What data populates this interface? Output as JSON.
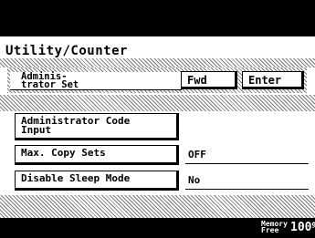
{
  "screen": {
    "title": "Utility/Counter",
    "header": {
      "admin_line1": "Adminis-",
      "admin_line2": "trator Set",
      "fwd_label": "Fwd",
      "enter_label": "Enter"
    },
    "items": [
      {
        "label_line1": "Administrator Code",
        "label_line2": "Input"
      },
      {
        "label": "Max. Copy Sets",
        "value": "OFF"
      },
      {
        "label": "Disable Sleep Mode",
        "value": "No"
      }
    ],
    "status": {
      "memory_label_line1": "Memory",
      "memory_label_line2": "Free",
      "memory_value": "100%"
    }
  }
}
